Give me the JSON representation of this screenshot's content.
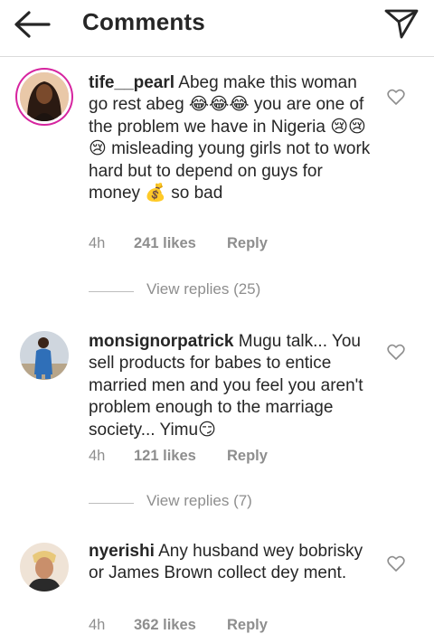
{
  "header": {
    "title": "Comments",
    "back_icon": "arrow-left-icon",
    "share_icon": "paper-plane-icon"
  },
  "comments": [
    {
      "username": "tife__pearl",
      "text_1": "Abeg make this woman go rest abeg",
      "emoji_1": "😂😂😂",
      "text_2": " you are one of the problem we have in Nigeria",
      "emoji_2": "😢😢😢",
      "text_3": " misleading young girls not to work hard but to depend on guys for money",
      "emoji_3": "💰",
      "text_4": " so bad",
      "time": "4h",
      "likes": "241 likes",
      "reply": "Reply",
      "view_replies": "View replies (25)"
    },
    {
      "username": "monsignorpatrick",
      "text_1": "Mugu talk... You sell products for babes to entice married men and you feel you aren't problem enough to the marriage society... Yimu",
      "emoji_1": "😏",
      "time": "4h",
      "likes": "121 likes",
      "reply": "Reply",
      "view_replies": "View replies (7)"
    },
    {
      "username": "nyerishi",
      "text_1": "Any husband wey bobrisky or James Brown collect dey ment.",
      "time": "4h",
      "likes": "362 likes",
      "reply": "Reply"
    }
  ],
  "colors": {
    "text": "#262626",
    "secondary": "#8e8e8e",
    "story_ring": "#d6249f",
    "divider": "#dbdbdb"
  }
}
